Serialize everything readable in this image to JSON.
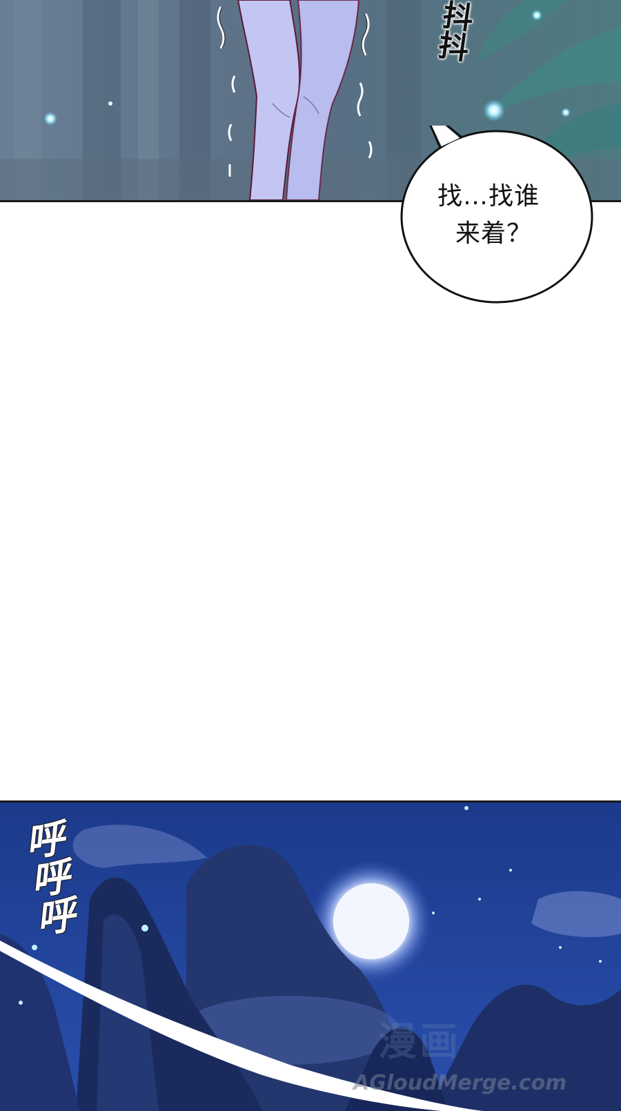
{
  "panels": {
    "top": {
      "sfx": "抖抖",
      "speech_bubble": {
        "text_line1": "找…找谁",
        "text_line2": "来着？"
      }
    },
    "bottom": {
      "sfx": "呼呼呼",
      "watermark": "AGloudMerge.com",
      "watermark_cn": "漫画"
    }
  },
  "colors": {
    "forest_bg": "#5d7289",
    "night_sky": "#1d3c86",
    "moon": "#f4f6ff",
    "legs": "#bfc3f2"
  }
}
